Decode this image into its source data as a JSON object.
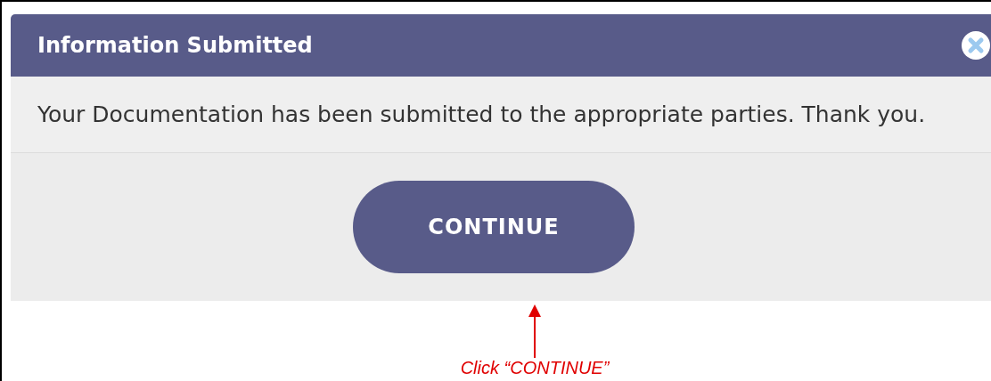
{
  "dialog": {
    "title": "Information Submitted",
    "message": "Your Documentation has been submitted to the appropriate parties. Thank you.",
    "buttons": [
      "CONTINUE"
    ]
  },
  "annotation": {
    "caption": "Click “CONTINUE”"
  }
}
